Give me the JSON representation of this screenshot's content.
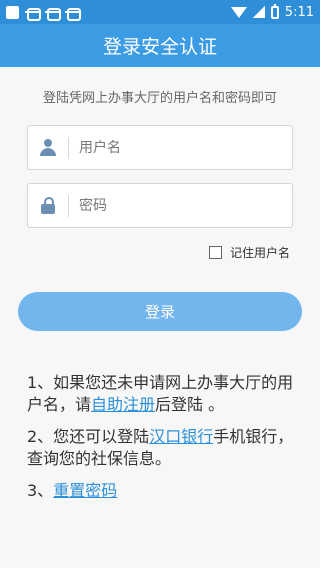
{
  "status": {
    "time": "5:11"
  },
  "header": {
    "title": "登录安全认证"
  },
  "subtitle": "登陆凭网上办事大厅的用户名和密码即可",
  "form": {
    "username_placeholder": "用户名",
    "password_placeholder": "密码",
    "remember_label": "记住用户名",
    "login_label": "登录"
  },
  "notes": {
    "n1_a": "1、如果您还未申请网上办事大厅的用户名，请",
    "n1_link": "自助注册",
    "n1_b": "后登陆 。",
    "n2_a": "2、您还可以登陆",
    "n2_link": "汉口银行",
    "n2_b": "手机银行，查询您的社保信息。",
    "n3_a": "3、",
    "n3_link": "重置密码"
  }
}
